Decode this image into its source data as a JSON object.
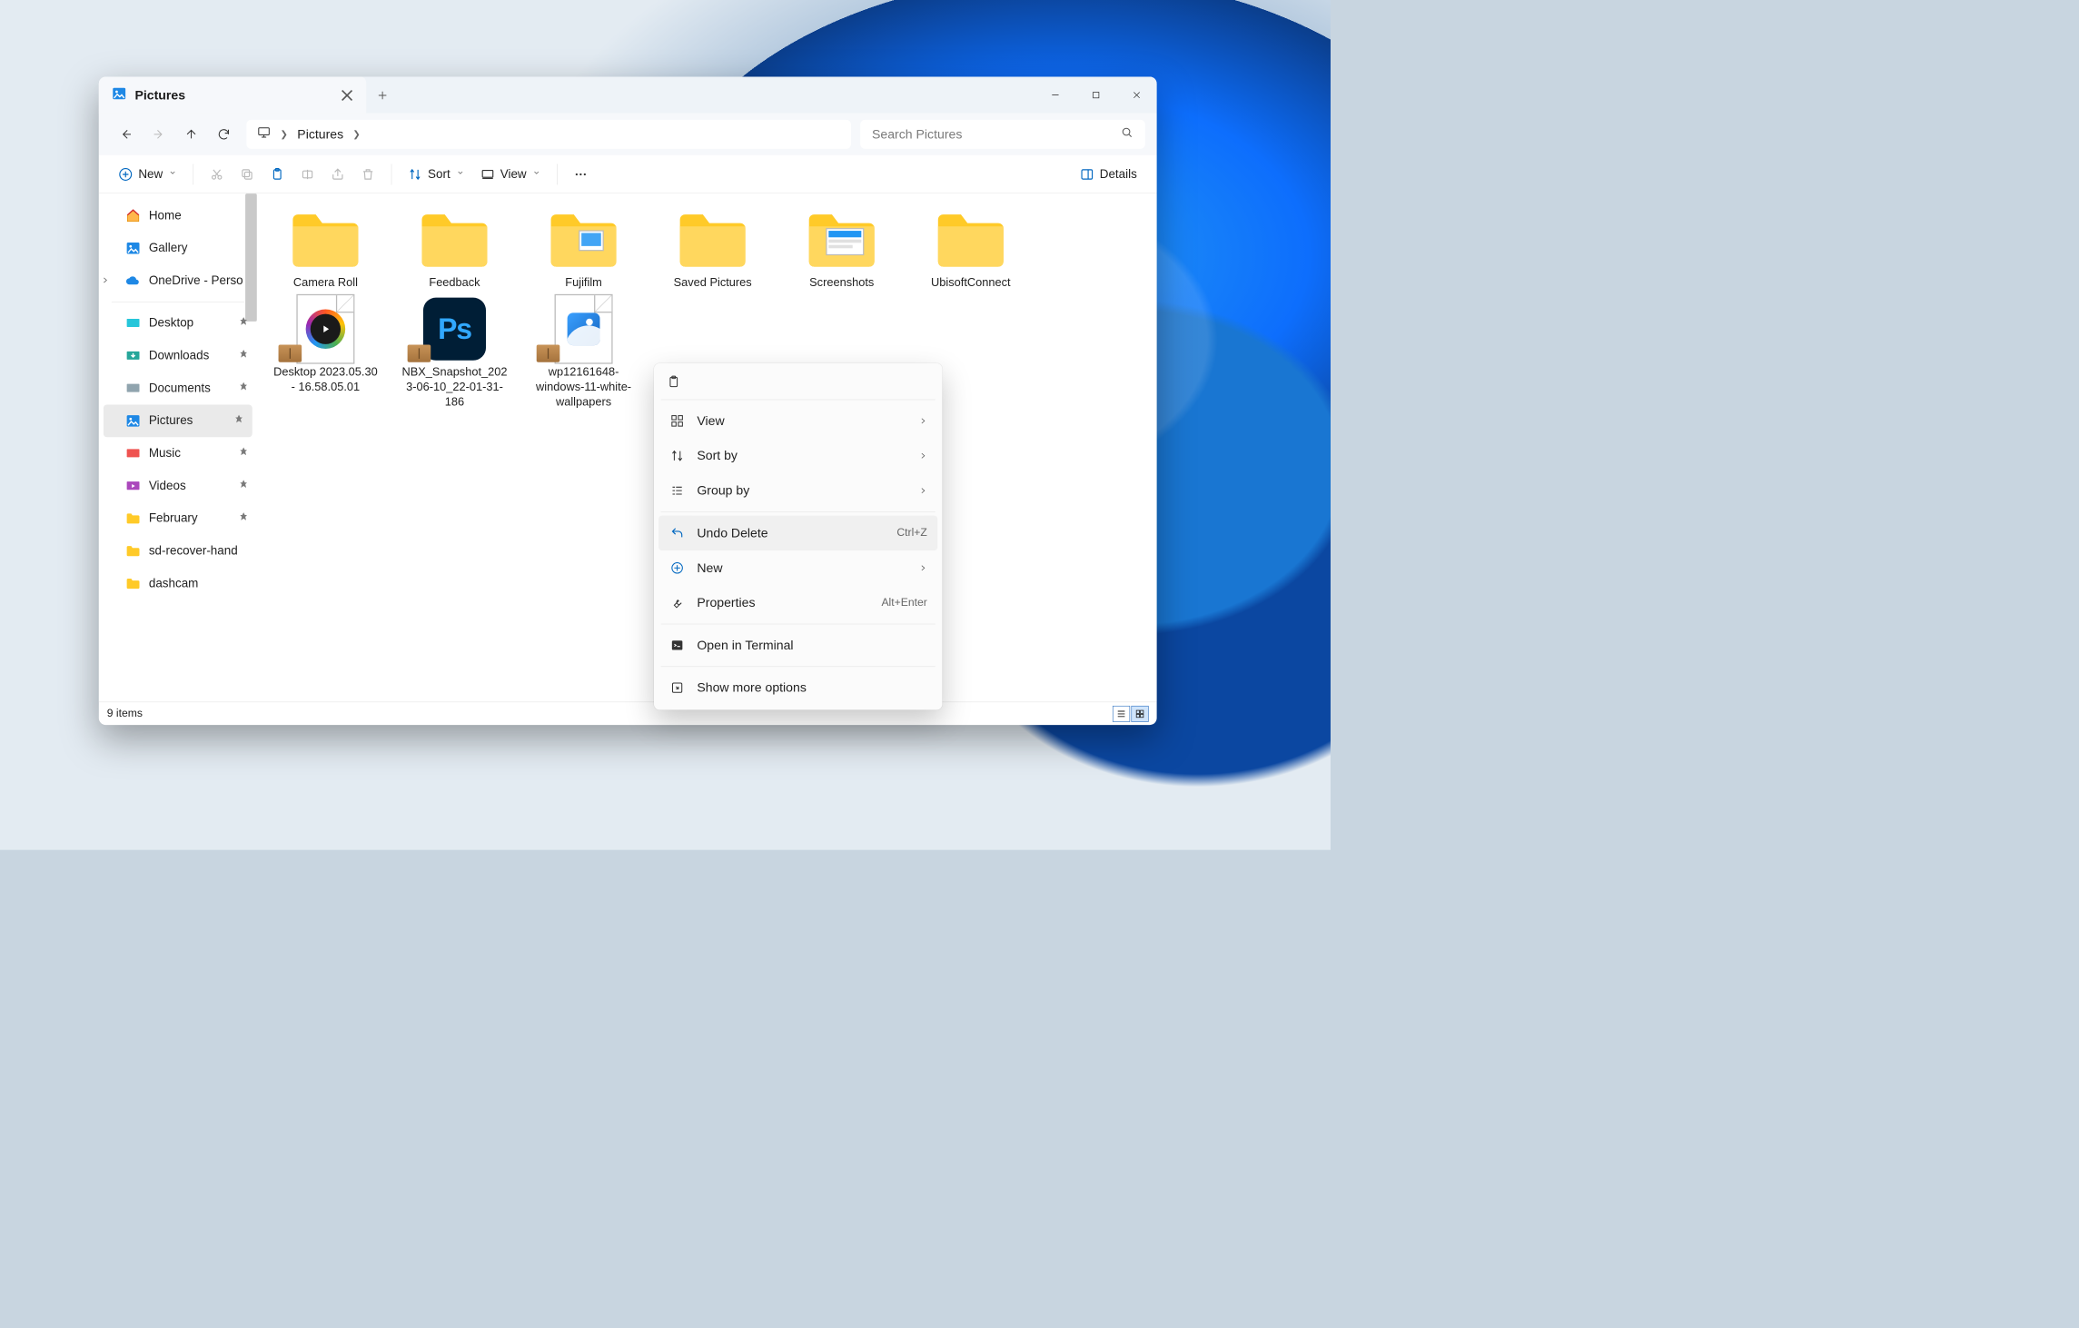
{
  "tab": {
    "title": "Pictures"
  },
  "address": {
    "location": "Pictures"
  },
  "search": {
    "placeholder": "Search Pictures"
  },
  "toolbar": {
    "new": "New",
    "sort": "Sort",
    "view": "View",
    "details": "Details"
  },
  "sidebar": {
    "home": "Home",
    "gallery": "Gallery",
    "onedrive": "OneDrive - Perso",
    "quick": {
      "desktop": "Desktop",
      "downloads": "Downloads",
      "documents": "Documents",
      "pictures": "Pictures",
      "music": "Music",
      "videos": "Videos",
      "february": "February",
      "sdrecover": "sd-recover-hand",
      "dashcam": "dashcam"
    }
  },
  "items": [
    {
      "name": "Camera Roll",
      "type": "folder"
    },
    {
      "name": "Feedback",
      "type": "folder"
    },
    {
      "name": "Fujifilm",
      "type": "folder-pic"
    },
    {
      "name": "Saved Pictures",
      "type": "folder"
    },
    {
      "name": "Screenshots",
      "type": "folder-shots"
    },
    {
      "name": "UbisoftConnect",
      "type": "folder"
    },
    {
      "name": "Desktop 2023.05.30 - 16.58.05.01",
      "type": "video"
    },
    {
      "name": "NBX_Snapshot_2023-06-10_22-01-31-186",
      "type": "ps"
    },
    {
      "name": "wp12161648-windows-11-white-wallpapers",
      "type": "image"
    }
  ],
  "context": {
    "view": "View",
    "sortby": "Sort by",
    "groupby": "Group by",
    "undo": "Undo Delete",
    "undo_shortcut": "Ctrl+Z",
    "new": "New",
    "properties": "Properties",
    "properties_shortcut": "Alt+Enter",
    "terminal": "Open in Terminal",
    "more": "Show more options"
  },
  "status": {
    "count": "9 items"
  }
}
